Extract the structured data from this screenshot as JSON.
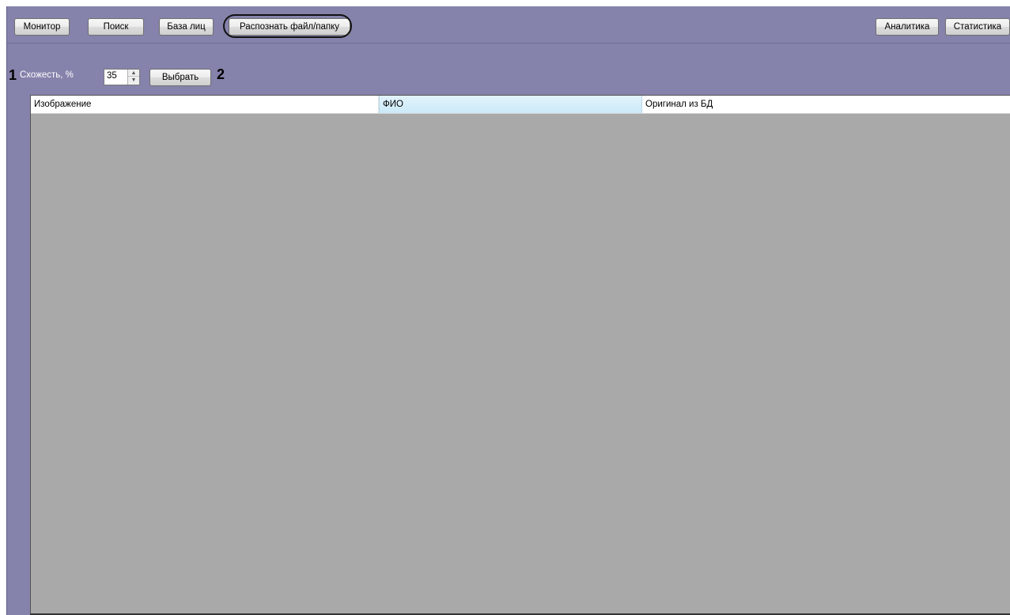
{
  "toolbar": {
    "monitor_label": "Монитор",
    "search_label": "Поиск",
    "faces_db_label": "База лиц",
    "recognize_label": "Распознать файл/папку",
    "analytics_label": "Аналитика",
    "statistics_label": "Статистика"
  },
  "filter": {
    "marker_1": "1",
    "similarity_label": "Схожесть, %",
    "similarity_value": "35",
    "choose_label": "Выбрать",
    "marker_2": "2"
  },
  "table": {
    "columns": [
      "Изображение",
      "ФИО",
      "Оригинал из БД"
    ],
    "rows": []
  },
  "colors": {
    "panel_background": "#8582ab",
    "table_background": "#a9a9a9",
    "selected_header": "#cbe9f8"
  }
}
